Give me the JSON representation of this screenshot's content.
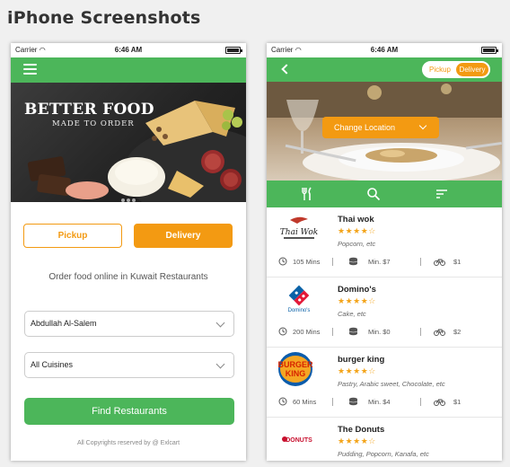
{
  "page": {
    "heading": "iPhone Screenshots"
  },
  "status": {
    "carrier": "Carrier",
    "time": "6:46 AM"
  },
  "home": {
    "banner_title": "BETTER FOOD",
    "banner_sub": "MADE TO ORDER",
    "pickup_label": "Pickup",
    "delivery_label": "Delivery",
    "tagline": "Order food online in Kuwait Restaurants",
    "area_value": "Abdullah Al-Salem",
    "cuisine_value": "All Cuisines",
    "find_label": "Find Restaurants",
    "copyright": "All Copyrights reserved by @ Exlcart"
  },
  "listing": {
    "toggle_pickup": "Pickup",
    "toggle_delivery": "Delivery",
    "change_location_label": "Change Location",
    "restaurants": [
      {
        "name": "Thai wok",
        "rating": 4,
        "cuisines": "Popcorn, etc",
        "time": "105 Mins",
        "min": "Min. $7",
        "fee": "$1",
        "logo_text": "Thai Wok",
        "logo_color": "#222222"
      },
      {
        "name": "Domino's",
        "rating": 4,
        "cuisines": "Cake, etc",
        "time": "200 Mins",
        "min": "Min. $0",
        "fee": "$2",
        "logo_text": "Domino's",
        "logo_color": "#0b62a8"
      },
      {
        "name": "burger king",
        "rating": 4,
        "cuisines": "Pastry, Arabic sweet, Chocolate, etc",
        "time": "60 Mins",
        "min": "Min. $4",
        "fee": "$1",
        "logo_text": "BURGER KING",
        "logo_color": "#d62300"
      },
      {
        "name": "The Donuts",
        "rating": 4,
        "cuisines": "Pudding, Popcorn, Kanafa, etc",
        "time": "",
        "min": "",
        "fee": "",
        "logo_text": "DONUTS",
        "logo_color": "#c8102e"
      }
    ]
  },
  "colors": {
    "green": "#4cb65a",
    "orange": "#f39a12"
  },
  "icons": [
    "menu-icon",
    "back-icon",
    "chevron-down-icon",
    "cutlery-icon",
    "search-icon",
    "sort-icon",
    "clock-icon",
    "coins-icon",
    "bicycle-icon"
  ]
}
